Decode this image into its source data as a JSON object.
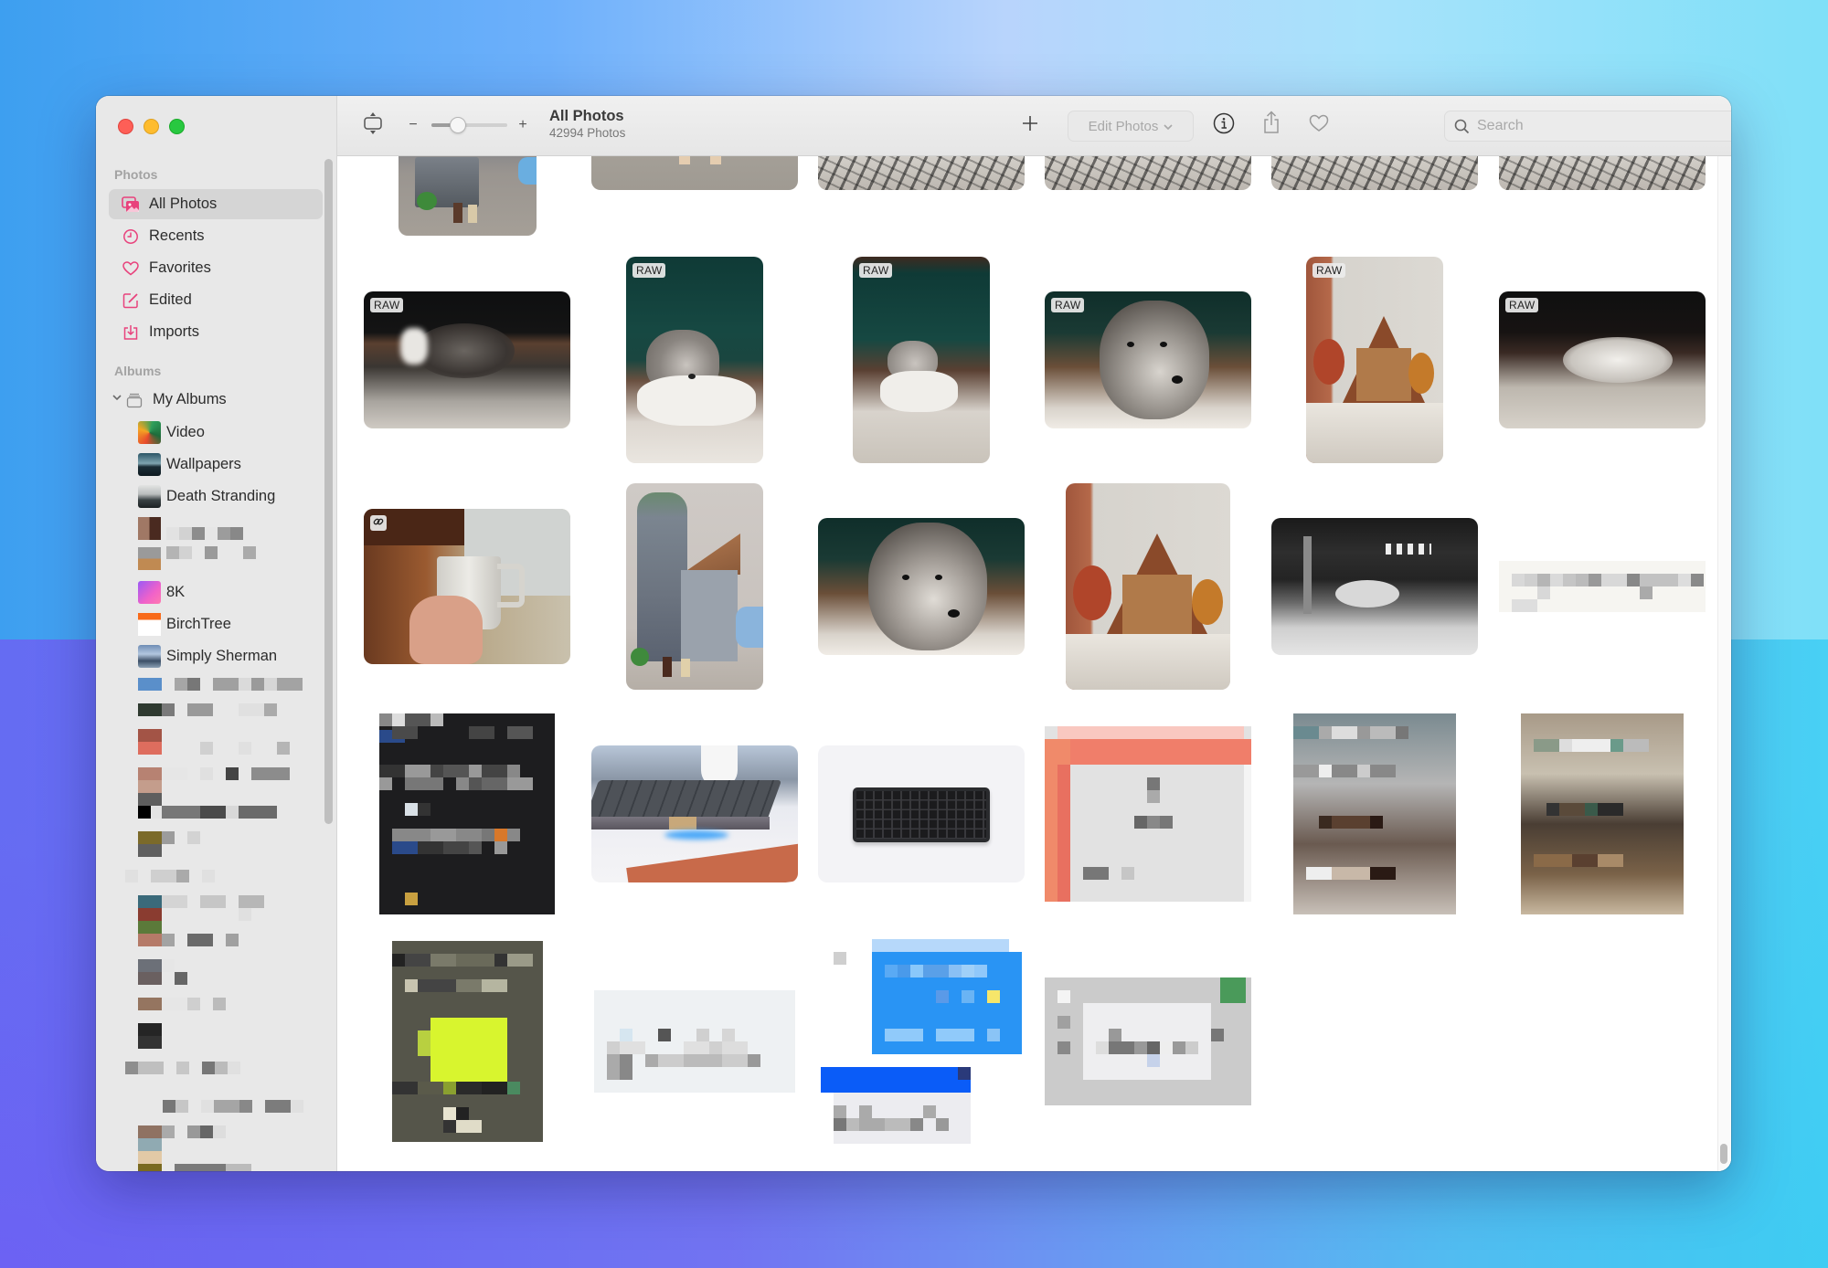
{
  "window": {
    "traffic_lights": [
      "close",
      "minimize",
      "zoom"
    ]
  },
  "sidebar": {
    "photos_header": "Photos",
    "library_items": [
      {
        "label": "All Photos",
        "icon": "photo-stack-icon",
        "selected": true
      },
      {
        "label": "Recents",
        "icon": "clock-icon",
        "selected": false
      },
      {
        "label": "Favorites",
        "icon": "heart-icon",
        "selected": false
      },
      {
        "label": "Edited",
        "icon": "edit-icon",
        "selected": false
      },
      {
        "label": "Imports",
        "icon": "import-icon",
        "selected": false
      }
    ],
    "albums_header": "Albums",
    "my_albums_label": "My Albums",
    "my_albums_expanded": true,
    "albums": [
      {
        "label": "Video"
      },
      {
        "label": "Wallpapers"
      },
      {
        "label": "Death Stranding"
      },
      {
        "label": "",
        "redacted": true
      },
      {
        "label": "",
        "redacted": true
      },
      {
        "label": "8K"
      },
      {
        "label": "BirchTree"
      },
      {
        "label": "Simply Sherman"
      }
    ],
    "accent_color": "#e8427c"
  },
  "toolbar": {
    "title": "All Photos",
    "subtitle": "42994 Photos",
    "zoom_minus": "−",
    "zoom_plus": "+",
    "zoom_slider_value": 0.35,
    "add_label": "+",
    "edit_photos_label": "Edit Photos",
    "edit_photos_enabled": false,
    "search_placeholder": "Search",
    "search_value": ""
  },
  "grid": {
    "rows": [
      [
        {
          "desc": "LEGO wizard tower (partial)",
          "orientation": "portrait"
        },
        {
          "desc": "LEGO minifigures on carpet (partial)",
          "orientation": "landscape"
        },
        {
          "desc": "Rug close-up (partial)",
          "orientation": "landscape"
        },
        {
          "desc": "Rug close-up (partial)",
          "orientation": "landscape"
        },
        {
          "desc": "Rug close-up (partial)",
          "orientation": "landscape"
        },
        {
          "desc": "Rug close-up (partial)",
          "orientation": "landscape"
        }
      ],
      [
        {
          "desc": "Dog lying on rug, blurred",
          "orientation": "landscape",
          "badge": "RAW"
        },
        {
          "desc": "Dog in front of green couch",
          "orientation": "portrait",
          "badge": "RAW"
        },
        {
          "desc": "Dog on rug by green couch",
          "orientation": "portrait",
          "badge": "RAW"
        },
        {
          "desc": "Dog close-up face",
          "orientation": "landscape",
          "badge": "RAW"
        },
        {
          "desc": "LEGO A-frame cabin",
          "orientation": "portrait",
          "badge": "RAW"
        },
        {
          "desc": "Dog sleeping on rug",
          "orientation": "landscape",
          "badge": "RAW"
        }
      ],
      [
        {
          "desc": "Hand holding white mug",
          "orientation": "landscape",
          "badge": "link"
        },
        {
          "desc": "LEGO wizard tower",
          "orientation": "portrait"
        },
        {
          "desc": "Dog close-up face",
          "orientation": "landscape"
        },
        {
          "desc": "LEGO A-frame cabin",
          "orientation": "portrait"
        },
        {
          "desc": "Dog lying under table, black & white",
          "orientation": "landscape"
        },
        {
          "desc": "Redacted screenshot",
          "orientation": "wide",
          "redacted": true
        }
      ],
      [
        {
          "desc": "Redacted dark screenshot",
          "orientation": "portrait",
          "redacted": true
        },
        {
          "desc": "Keyboard on desk with blue glow",
          "orientation": "landscape"
        },
        {
          "desc": "Compact keyboard on white",
          "orientation": "landscape"
        },
        {
          "desc": "Redacted screenshot",
          "orientation": "square",
          "redacted": true
        },
        {
          "desc": "Redacted screenshot",
          "orientation": "portrait",
          "redacted": true
        },
        {
          "desc": "Redacted screenshot",
          "orientation": "portrait",
          "redacted": true
        }
      ],
      [
        {
          "desc": "Redacted screenshot",
          "orientation": "portrait",
          "redacted": true
        },
        {
          "desc": "Redacted screenshot",
          "orientation": "wide",
          "redacted": true
        },
        {
          "desc": "Redacted screenshot",
          "orientation": "square",
          "redacted": true
        },
        {
          "desc": "Redacted screenshot",
          "orientation": "landscape",
          "redacted": true
        }
      ]
    ]
  }
}
